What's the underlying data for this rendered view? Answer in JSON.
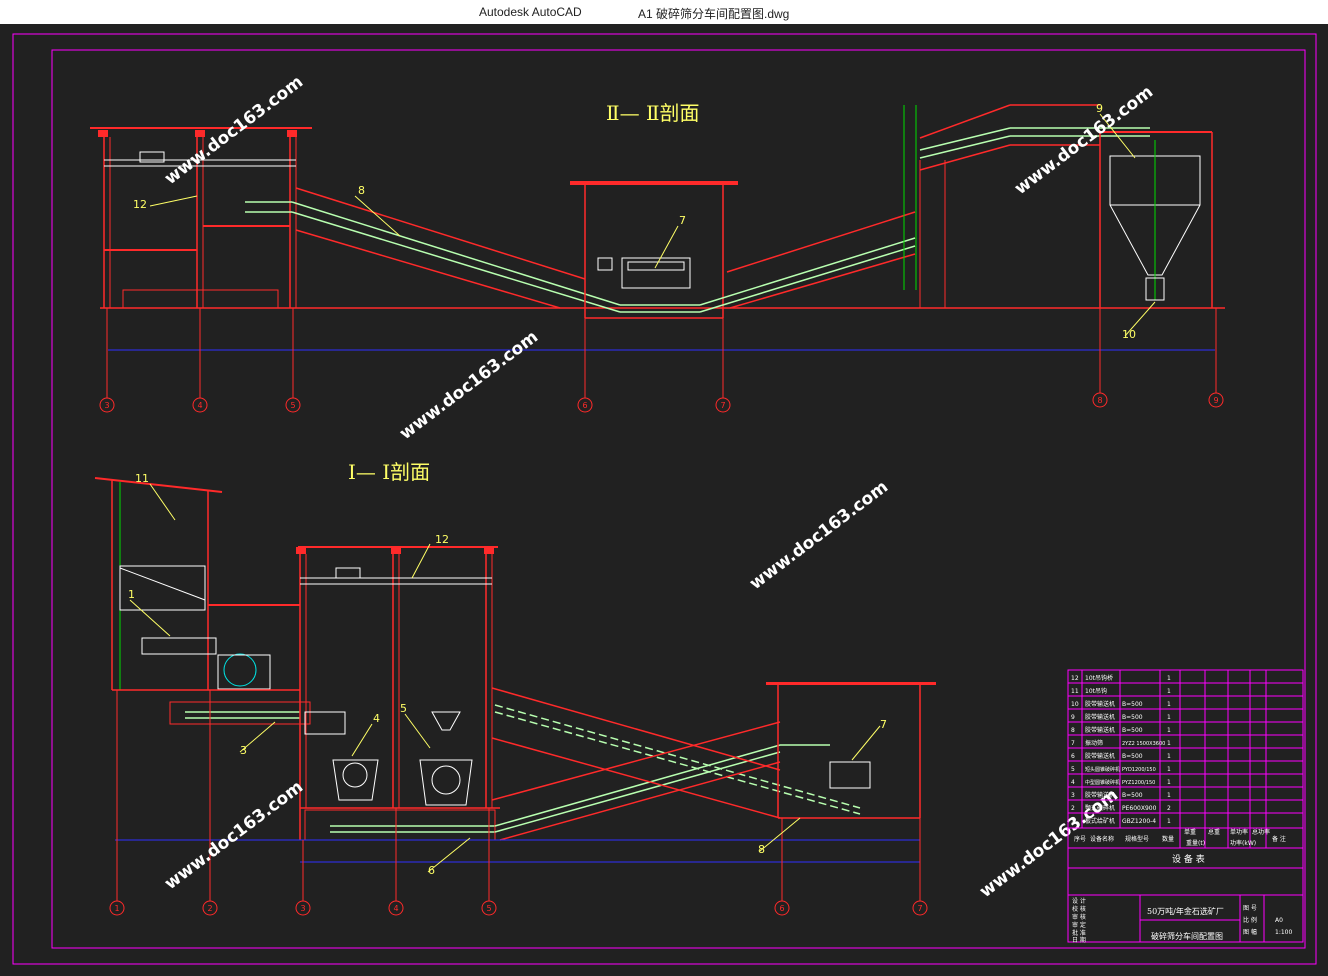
{
  "window": {
    "app_name": "Autodesk AutoCAD",
    "document_title": "A1  破碎筛分车间配置图.dwg"
  },
  "drawing": {
    "section_top_title": "Ⅱ— Ⅱ剖面",
    "section_bottom_title": "Ⅰ— Ⅰ剖面",
    "watermark": "www.doc163.com",
    "top_axis_labels": [
      "3",
      "4",
      "5",
      "6",
      "7",
      "8",
      "9"
    ],
    "bottom_axis_labels": [
      "1",
      "2",
      "3",
      "4",
      "5",
      "6",
      "7"
    ],
    "top_callouts": [
      "12",
      "8",
      "7",
      "9",
      "10"
    ],
    "bottom_callouts": [
      "11",
      "12",
      "1",
      "4",
      "5",
      "7",
      "3",
      "6",
      "8"
    ]
  },
  "equipment_table": {
    "rows": [
      {
        "no": "12",
        "name": "10t吊钩桥",
        "spec": "",
        "qty": "1"
      },
      {
        "no": "11",
        "name": "10t吊钩",
        "spec": "",
        "qty": "1"
      },
      {
        "no": "10",
        "name": "胶带输送机",
        "spec": "B=500",
        "qty": "1"
      },
      {
        "no": "9",
        "name": "胶带输送机",
        "spec": "B=500",
        "qty": "1"
      },
      {
        "no": "8",
        "name": "胶带输送机",
        "spec": "B=500",
        "qty": "1"
      },
      {
        "no": "7",
        "name": "振动筛",
        "spec": "2YZ2 1500X3600",
        "qty": "1"
      },
      {
        "no": "6",
        "name": "胶带输送机",
        "spec": "B=500",
        "qty": "1"
      },
      {
        "no": "5",
        "name": "短头圆锥破碎机",
        "spec": "PYD1200/150",
        "qty": "1"
      },
      {
        "no": "4",
        "name": "中型圆锥破碎机",
        "spec": "PYZ1200/150",
        "qty": "1"
      },
      {
        "no": "3",
        "name": "胶带输送机",
        "spec": "B=500",
        "qty": "1"
      },
      {
        "no": "2",
        "name": "颚式破碎机",
        "spec": "PE600X900",
        "qty": "2"
      },
      {
        "no": "1",
        "name": "板式给矿机",
        "spec": "GBZ1200-4",
        "qty": "1"
      }
    ],
    "header": {
      "no": "序号",
      "name": "设备名称",
      "spec": "规格型号",
      "qty": "数量",
      "unit_weight": "单重",
      "total_weight": "总重",
      "unit_power": "单功率",
      "total_power": "总功率",
      "remark": "备 注"
    },
    "weight_unit": "重量(t)",
    "power_unit": "功率(kW)",
    "title": "设 备 表",
    "project_name": "50万吨/年金石选矿厂",
    "drawing_name": "破碎筛分车间配置图",
    "signature_rows": [
      "设 计",
      "校 核",
      "审 核",
      "审 定",
      "批 准",
      "日 期"
    ],
    "right_labels": [
      "图 号",
      "比 例",
      "图 幅"
    ],
    "scale": "1:100",
    "size": "A0"
  },
  "colors": {
    "frame": "#ff00ff",
    "structure": "#ff2a2a",
    "conveyor": "#b8ffb0",
    "axis": "#ff2a2a",
    "dimension": "#3030ff",
    "callout": "#ffff66",
    "machine": "#ffffff",
    "cyan": "#00e5e5",
    "green": "#00dd00"
  }
}
